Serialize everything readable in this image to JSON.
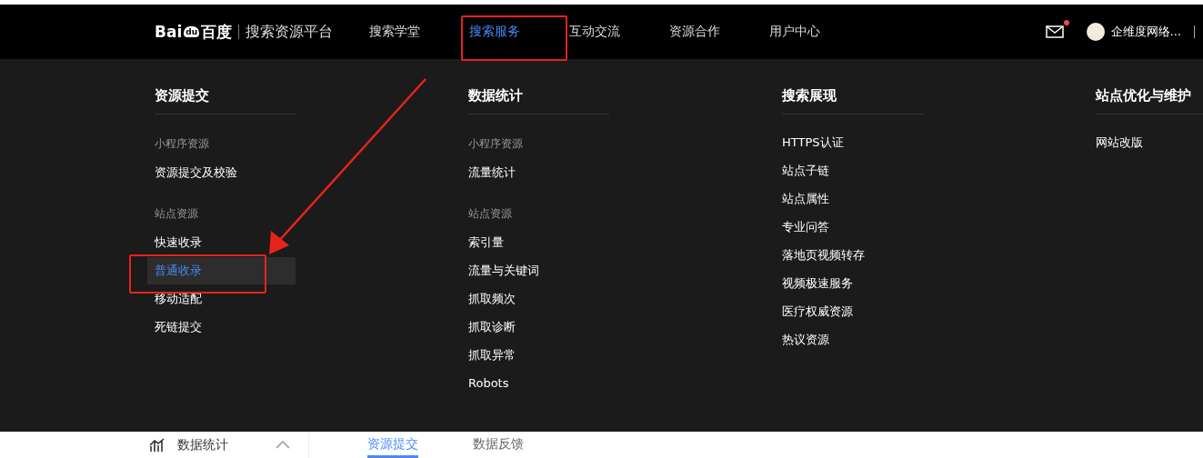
{
  "header": {
    "logo": {
      "left": "Bai",
      "paw": "du",
      "right": "百度"
    },
    "platform": "搜索资源平台",
    "nav": [
      {
        "label": "搜索学堂",
        "selected": false
      },
      {
        "label": "搜索服务",
        "selected": true
      },
      {
        "label": "互动交流",
        "selected": false
      },
      {
        "label": "资源合作",
        "selected": false
      },
      {
        "label": "用户中心",
        "selected": false
      }
    ],
    "messages_unread": true,
    "user": "企维度网络..."
  },
  "menu": {
    "columns": [
      {
        "title": "资源提交",
        "groups": [
          {
            "heading": "小程序资源",
            "items": [
              {
                "label": "资源提交及校验",
                "selected": false
              }
            ]
          },
          {
            "heading": "站点资源",
            "items": [
              {
                "label": "快速收录",
                "selected": false
              },
              {
                "label": "普通收录",
                "selected": true
              },
              {
                "label": "移动适配",
                "selected": false
              },
              {
                "label": "死链提交",
                "selected": false
              }
            ]
          }
        ]
      },
      {
        "title": "数据统计",
        "groups": [
          {
            "heading": "小程序资源",
            "items": [
              {
                "label": "流量统计",
                "selected": false
              }
            ]
          },
          {
            "heading": "站点资源",
            "items": [
              {
                "label": "索引量",
                "selected": false
              },
              {
                "label": "流量与关键词",
                "selected": false
              },
              {
                "label": "抓取频次",
                "selected": false
              },
              {
                "label": "抓取诊断",
                "selected": false
              },
              {
                "label": "抓取异常",
                "selected": false
              },
              {
                "label": "Robots",
                "selected": false
              }
            ]
          }
        ]
      },
      {
        "title": "搜索展现",
        "groups": [
          {
            "items": [
              {
                "label": "HTTPS认证",
                "selected": false
              },
              {
                "label": "站点子链",
                "selected": false
              },
              {
                "label": "站点属性",
                "selected": false
              },
              {
                "label": "专业问答",
                "selected": false
              },
              {
                "label": "落地页视频转存",
                "selected": false
              },
              {
                "label": "视频极速服务",
                "selected": false
              },
              {
                "label": "医疗权威资源",
                "selected": false
              },
              {
                "label": "热议资源",
                "selected": false
              }
            ]
          }
        ]
      },
      {
        "title": "站点优化与维护",
        "groups": [
          {
            "items": [
              {
                "label": "网站改版",
                "selected": false
              }
            ]
          }
        ]
      }
    ]
  },
  "sidebar": {
    "item": {
      "label": "数据统计",
      "expanded": true
    }
  },
  "tabs": [
    {
      "label": "资源提交",
      "selected": true
    },
    {
      "label": "数据反馈",
      "selected": false
    }
  ]
}
